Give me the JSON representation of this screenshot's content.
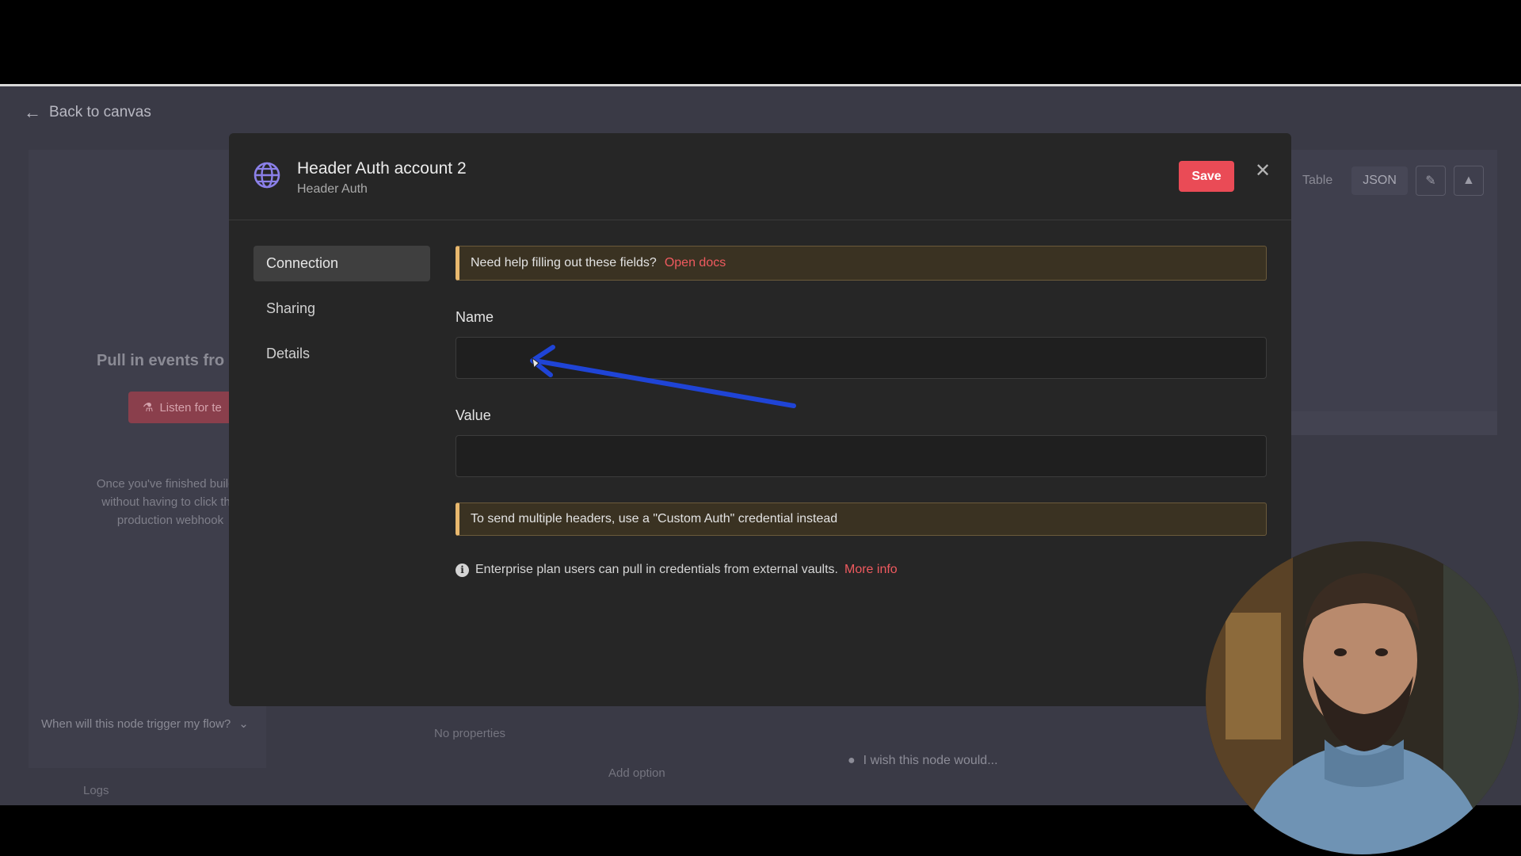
{
  "background": {
    "back_link": "Back to canvas",
    "title": "Pull in events fro",
    "listen_button": "Listen for te",
    "help_text": "Once you've finished buildin\nwithout having to click this\nproduction webhook",
    "trigger_question": "When will this node trigger my flow?",
    "no_properties": "No properties",
    "add_option": "Add option",
    "wish_text": "I wish this node would...",
    "logs": "Logs",
    "tabs": [
      "Table",
      "JSON"
    ]
  },
  "modal": {
    "title": "Header Auth account 2",
    "subtitle": "Header Auth",
    "save_label": "Save",
    "close_icon": "close-icon",
    "nav": [
      {
        "label": "Connection",
        "active": true
      },
      {
        "label": "Sharing",
        "active": false
      },
      {
        "label": "Details",
        "active": false
      }
    ],
    "help_callout": {
      "text": "Need help filling out these fields?",
      "link": "Open docs"
    },
    "name_field": {
      "label": "Name",
      "value": ""
    },
    "value_field": {
      "label": "Value",
      "value": ""
    },
    "multi_callout": "To send multiple headers, use a \"Custom Auth\" credential instead",
    "enterprise_note": {
      "text": "Enterprise plan users can pull in credentials from external vaults.",
      "link": "More info"
    }
  },
  "colors": {
    "accent": "#ea4b56",
    "link": "#ef5a5f",
    "callout_border": "#e8b86e",
    "annotation_arrow": "#1f44d6"
  }
}
